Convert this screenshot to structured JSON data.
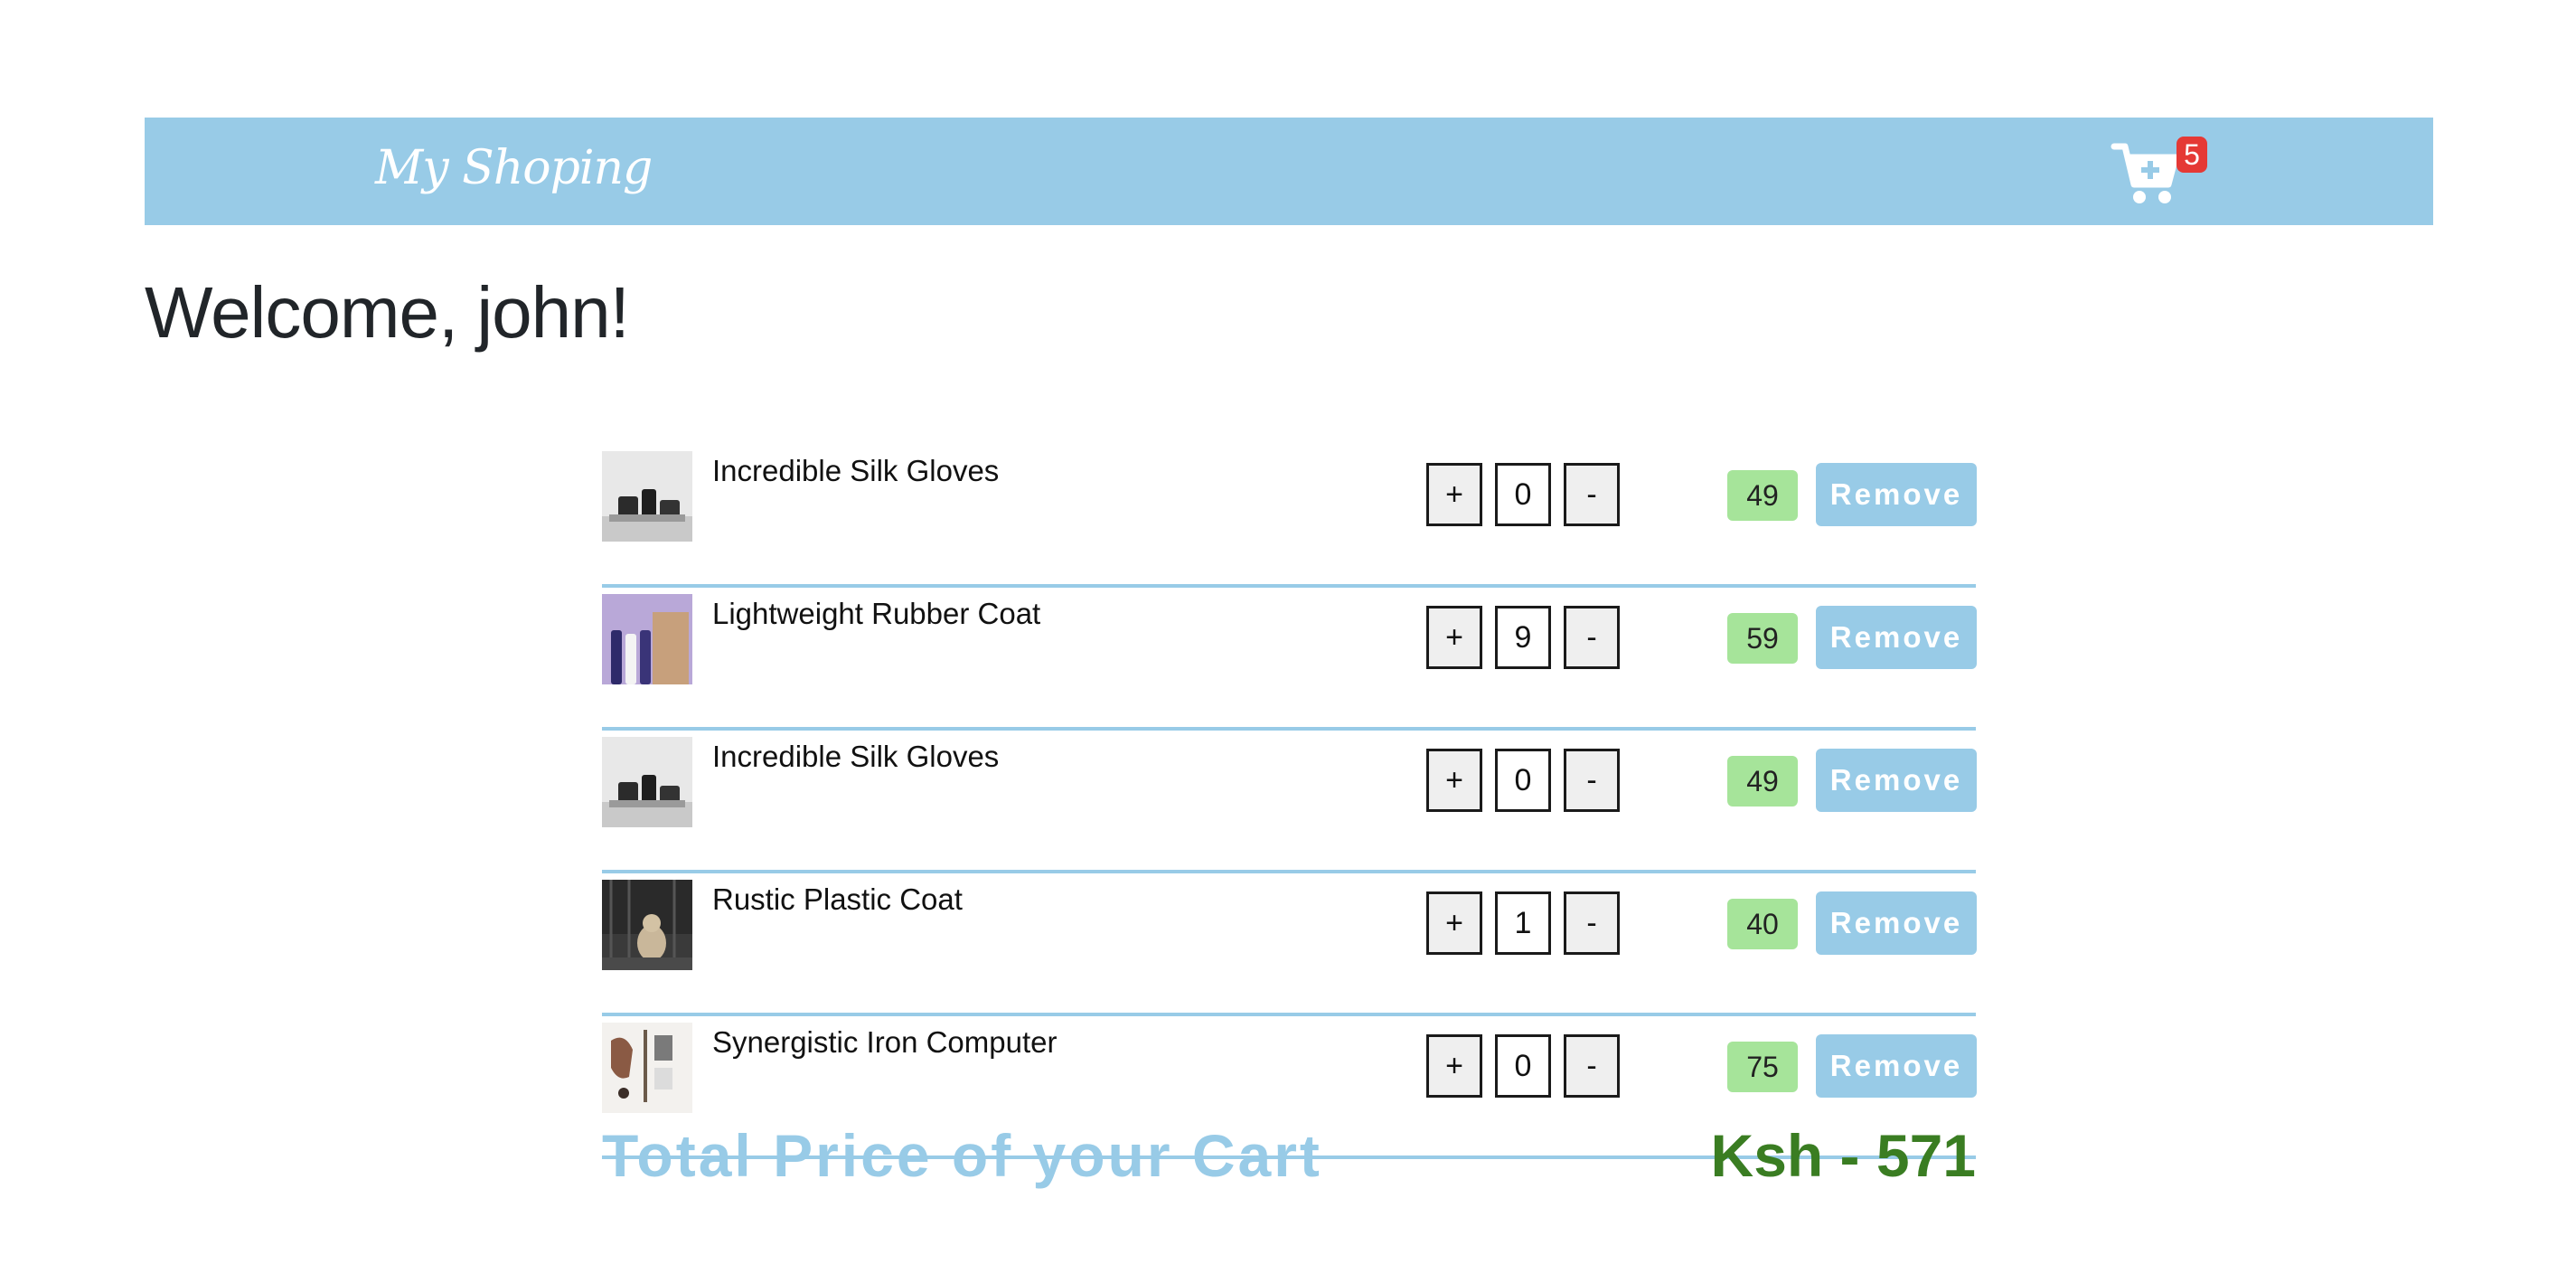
{
  "navbar": {
    "brand": "My Shoping",
    "cart_count": "5",
    "colors": {
      "background": "#98cbe7",
      "badge": "#e53935"
    },
    "cart_icon": "cart-plus-icon"
  },
  "welcome": "Welcome, john!",
  "cart": {
    "items": [
      {
        "name": "Incredible Silk Gloves",
        "plus": "+",
        "quantity": "0",
        "minus": "-",
        "price": "49",
        "remove": "Remove",
        "thumb": "skincare-jars-image"
      },
      {
        "name": "Lightweight Rubber Coat",
        "plus": "+",
        "quantity": "9",
        "minus": "-",
        "price": "59",
        "remove": "Remove",
        "thumb": "tubes-box-image"
      },
      {
        "name": "Incredible Silk Gloves",
        "plus": "+",
        "quantity": "0",
        "minus": "-",
        "price": "49",
        "remove": "Remove",
        "thumb": "skincare-jars-image"
      },
      {
        "name": "Rustic Plastic Coat",
        "plus": "+",
        "quantity": "1",
        "minus": "-",
        "price": "40",
        "remove": "Remove",
        "thumb": "cat-photo-image"
      },
      {
        "name": "Synergistic Iron Computer",
        "plus": "+",
        "quantity": "0",
        "minus": "-",
        "price": "75",
        "remove": "Remove",
        "thumb": "flatlay-items-image"
      }
    ],
    "colors": {
      "price_badge": "#a6e49a",
      "remove_button": "#98cbe7",
      "divider": "#98cbe7"
    }
  },
  "total": {
    "label": "Total Price of your Cart",
    "value": "Ksh - 571",
    "colors": {
      "label": "#98cbe7",
      "value": "#3a7d22"
    }
  }
}
